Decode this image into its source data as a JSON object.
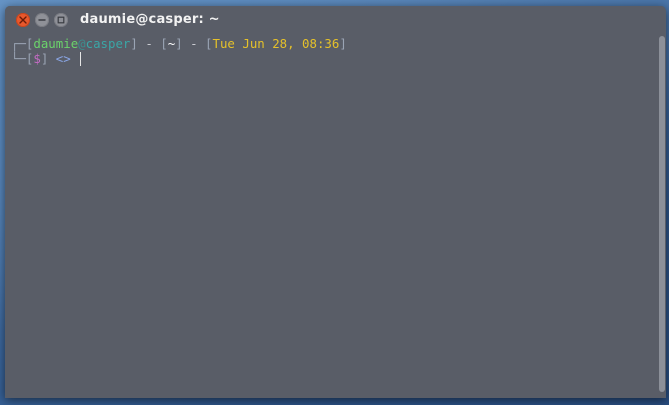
{
  "window": {
    "title": "daumie@casper: ~"
  },
  "titlebar": {
    "buttons": [
      {
        "name": "close",
        "icon": "close-icon"
      },
      {
        "name": "minimize",
        "icon": "minimize-icon"
      },
      {
        "name": "maximize",
        "icon": "maximize-icon"
      }
    ]
  },
  "terminal": {
    "line1": {
      "frame": "┌─",
      "open_bracket": "[",
      "user": "daumie",
      "at": "@",
      "host": "casper",
      "close_bracket": "]",
      "sep1": " - ",
      "dir_open": "[",
      "dir": "~",
      "dir_close": "]",
      "sep2": " - ",
      "date_open": "[",
      "date": "Tue Jun 28, 08:36",
      "date_close": "]"
    },
    "line2": {
      "frame": "└─",
      "open_bracket": "[",
      "dollar": "$",
      "close_bracket": "]",
      "arrow": " <> "
    }
  },
  "colors": {
    "window_bg": "#595d67",
    "close_button": "#e9582c",
    "user": "#6bd36b",
    "host": "#3aa6a6",
    "date": "#e5c12a",
    "dollar": "#c46bc4",
    "arrow": "#8aa6e6"
  }
}
